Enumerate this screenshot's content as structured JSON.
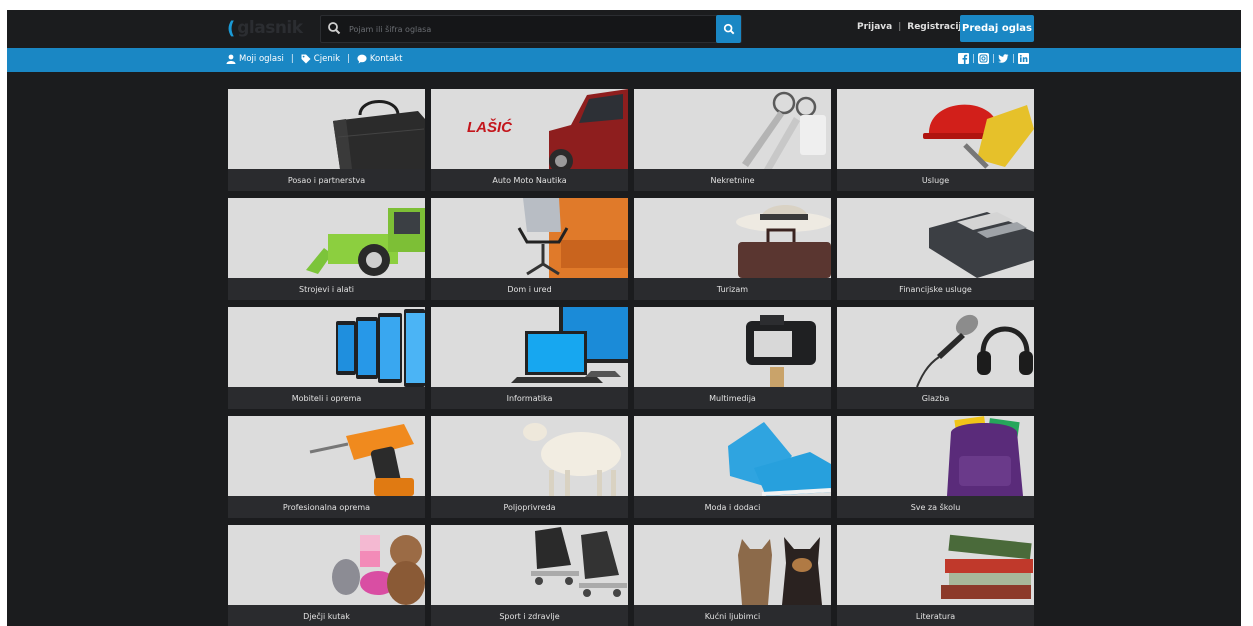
{
  "logo": {
    "text": "glasnik"
  },
  "search": {
    "placeholder": "Pojam ili šifra oglasa"
  },
  "header": {
    "login": "Prijava",
    "separator": "|",
    "register": "Registracija",
    "post_ad": "Predaj oglas"
  },
  "nav": {
    "my_ads": "Moji oglasi",
    "pricing": "Cjenik",
    "contact": "Kontakt",
    "separator": "|"
  },
  "social": [
    "facebook-icon",
    "instagram-icon",
    "twitter-icon",
    "linkedin-icon"
  ],
  "colors": {
    "accent": "#1a87c4",
    "background": "#1b1c1e",
    "tile": "#2a2b2e"
  },
  "categories": [
    {
      "label": "Posao i partnerstva",
      "icon": "laptop-bag-icon"
    },
    {
      "label": "Auto Moto Nautika",
      "icon": "car-icon",
      "image_text": "LAŠIĆ"
    },
    {
      "label": "Nekretnine",
      "icon": "keys-icon"
    },
    {
      "label": "Usluge",
      "icon": "hardhat-icon"
    },
    {
      "label": "Strojevi i alati",
      "icon": "tractor-icon"
    },
    {
      "label": "Dom i ured",
      "icon": "chair-icon"
    },
    {
      "label": "Turizam",
      "icon": "suitcase-hat-icon"
    },
    {
      "label": "Financijske usluge",
      "icon": "wallet-icon"
    },
    {
      "label": "Mobiteli i oprema",
      "icon": "phones-icon"
    },
    {
      "label": "Informatika",
      "icon": "computers-icon"
    },
    {
      "label": "Multimedija",
      "icon": "camera-icon"
    },
    {
      "label": "Glazba",
      "icon": "microphone-icon"
    },
    {
      "label": "Profesionalna oprema",
      "icon": "drill-icon"
    },
    {
      "label": "Poljoprivreda",
      "icon": "sheep-icon"
    },
    {
      "label": "Moda i dodaci",
      "icon": "sneakers-icon"
    },
    {
      "label": "Sve za školu",
      "icon": "backpack-icon"
    },
    {
      "label": "Dječji kutak",
      "icon": "toys-icon"
    },
    {
      "label": "Sport i zdravlje",
      "icon": "skates-icon"
    },
    {
      "label": "Kućni ljubimci",
      "icon": "pets-icon"
    },
    {
      "label": "Literatura",
      "icon": "books-icon"
    }
  ]
}
